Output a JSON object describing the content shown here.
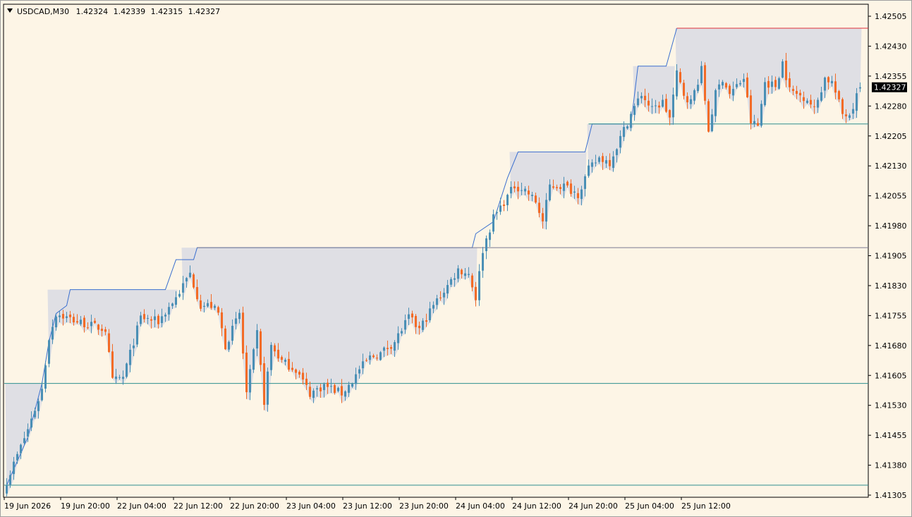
{
  "header": {
    "symbol": "USDCAD,M30",
    "open": "1.42324",
    "high": "1.42339",
    "low": "1.42315",
    "close": "1.42327"
  },
  "current_price_label": "1.42327",
  "colors": {
    "background": "#fdf5e6",
    "bull_candle": "#4a8fb5",
    "bear_candle": "#f36b26",
    "channel_fill": "#dfdfe4",
    "channel_upper": "#3a6fcf",
    "resistance_level": "#e0303a",
    "support_level": "#2e8f8f",
    "neutral_level": "#7a7a92",
    "price_tag_bg": "#000000",
    "price_tag_text": "#ffffff"
  },
  "chart_data": {
    "type": "candlestick",
    "title": "USDCAD,M30",
    "ylim": [
      1.41305,
      1.42505
    ],
    "y_ticks": [
      "1.42505",
      "1.42430",
      "1.42355",
      "1.42280",
      "1.42205",
      "1.42130",
      "1.42055",
      "1.41980",
      "1.41905",
      "1.41830",
      "1.41755",
      "1.41680",
      "1.41605",
      "1.41530",
      "1.41455",
      "1.41380",
      "1.41305"
    ],
    "x_ticks": [
      "19 Jun 2026",
      "19 Jun 20:00",
      "22 Jun 04:00",
      "22 Jun 12:00",
      "22 Jun 20:00",
      "23 Jun 04:00",
      "23 Jun 12:00",
      "23 Jun 20:00",
      "24 Jun 04:00",
      "24 Jun 12:00",
      "24 Jun 20:00",
      "25 Jun 04:00",
      "25 Jun 12:00"
    ],
    "bars_per_x_tick": 16,
    "last_price": 1.42327,
    "horizontal_levels": [
      {
        "price": 1.42475,
        "from_bar": 190,
        "kind": "resistance"
      },
      {
        "price": 1.42235,
        "from_bar": 165,
        "kind": "support"
      },
      {
        "price": 1.41925,
        "from_bar": 54,
        "kind": "neutral"
      },
      {
        "price": 1.41585,
        "from_bar": 0,
        "kind": "support"
      },
      {
        "price": 1.4133,
        "from_bar": 0,
        "kind": "support"
      }
    ],
    "channel_zones": [
      {
        "from_bar": 0,
        "to_bar": 10,
        "top": 1.41585
      },
      {
        "from_bar": 12,
        "to_bar": 48,
        "top": 1.4182
      },
      {
        "from_bar": 50,
        "to_bar": 133,
        "top": 1.41925
      },
      {
        "from_bar": 143,
        "to_bar": 164,
        "top": 1.42165
      },
      {
        "from_bar": 165,
        "to_bar": 178,
        "top": 1.42235
      },
      {
        "from_bar": 178,
        "to_bar": 189,
        "top": 1.4238
      },
      {
        "from_bar": 190,
        "to_bar": 242,
        "top": 1.42475
      }
    ],
    "channel_upper_line": [
      [
        0,
        1.4133
      ],
      [
        6,
        1.4145
      ],
      [
        10,
        1.41585
      ],
      [
        12,
        1.4169
      ],
      [
        14,
        1.4176
      ],
      [
        17,
        1.4178
      ],
      [
        18,
        1.4182
      ],
      [
        45,
        1.4182
      ],
      [
        48,
        1.41895
      ],
      [
        53,
        1.41895
      ],
      [
        54,
        1.41925
      ],
      [
        132,
        1.41925
      ],
      [
        133,
        1.4196
      ],
      [
        138,
        1.4199
      ],
      [
        142,
        1.421
      ],
      [
        145,
        1.42165
      ],
      [
        164,
        1.42165
      ],
      [
        166,
        1.42235
      ],
      [
        177,
        1.42235
      ],
      [
        179,
        1.4238
      ],
      [
        187,
        1.4238
      ],
      [
        190,
        1.42475
      ]
    ],
    "series": [
      {
        "anchors": [
          [
            0,
            1.4134
          ],
          [
            6,
            1.4147
          ],
          [
            10,
            1.4157
          ],
          [
            12,
            1.417
          ],
          [
            14,
            1.4176
          ],
          [
            20,
            1.4174
          ],
          [
            28,
            1.4172
          ],
          [
            30,
            1.4159
          ],
          [
            33,
            1.416
          ],
          [
            38,
            1.4175
          ],
          [
            43,
            1.4174
          ],
          [
            48,
            1.418
          ],
          [
            52,
            1.4186
          ],
          [
            55,
            1.4178
          ],
          [
            58,
            1.4178
          ],
          [
            60,
            1.4176
          ],
          [
            62,
            1.4168
          ],
          [
            66,
            1.4176
          ],
          [
            68,
            1.4156
          ],
          [
            71,
            1.4171
          ],
          [
            73,
            1.4154
          ],
          [
            75,
            1.4168
          ],
          [
            78,
            1.4164
          ],
          [
            82,
            1.4162
          ],
          [
            86,
            1.4156
          ],
          [
            90,
            1.4158
          ],
          [
            95,
            1.4156
          ],
          [
            98,
            1.4159
          ],
          [
            100,
            1.4162
          ],
          [
            103,
            1.4165
          ],
          [
            106,
            1.4166
          ],
          [
            110,
            1.4169
          ],
          [
            114,
            1.4175
          ],
          [
            117,
            1.4172
          ],
          [
            121,
            1.4178
          ],
          [
            125,
            1.4183
          ],
          [
            128,
            1.4187
          ],
          [
            131,
            1.4186
          ],
          [
            133,
            1.418
          ],
          [
            135,
            1.4192
          ],
          [
            138,
            1.42
          ],
          [
            141,
            1.4204
          ],
          [
            144,
            1.4208
          ],
          [
            147,
            1.4207
          ],
          [
            150,
            1.4204
          ],
          [
            152,
            1.4199
          ],
          [
            154,
            1.4208
          ],
          [
            158,
            1.4208
          ],
          [
            162,
            1.4206
          ],
          [
            165,
            1.4212
          ],
          [
            168,
            1.4215
          ],
          [
            171,
            1.4214
          ],
          [
            174,
            1.422
          ],
          [
            177,
            1.4226
          ],
          [
            180,
            1.4231
          ],
          [
            183,
            1.4227
          ],
          [
            186,
            1.4229
          ],
          [
            188,
            1.4225
          ],
          [
            190,
            1.4236
          ],
          [
            192,
            1.4231
          ],
          [
            194,
            1.4229
          ],
          [
            197,
            1.4237
          ],
          [
            199,
            1.4222
          ],
          [
            201,
            1.4231
          ],
          [
            203,
            1.4235
          ],
          [
            205,
            1.4231
          ],
          [
            207,
            1.4233
          ],
          [
            209,
            1.4235
          ],
          [
            211,
            1.4224
          ],
          [
            213,
            1.4223
          ],
          [
            215,
            1.4234
          ],
          [
            218,
            1.4233
          ],
          [
            220,
            1.4239
          ],
          [
            222,
            1.4232
          ],
          [
            224,
            1.4231
          ],
          [
            227,
            1.423
          ],
          [
            229,
            1.4227
          ],
          [
            232,
            1.4235
          ],
          [
            234,
            1.4234
          ],
          [
            237,
            1.4226
          ],
          [
            239,
            1.4226
          ],
          [
            242,
            1.42327
          ]
        ]
      }
    ]
  }
}
